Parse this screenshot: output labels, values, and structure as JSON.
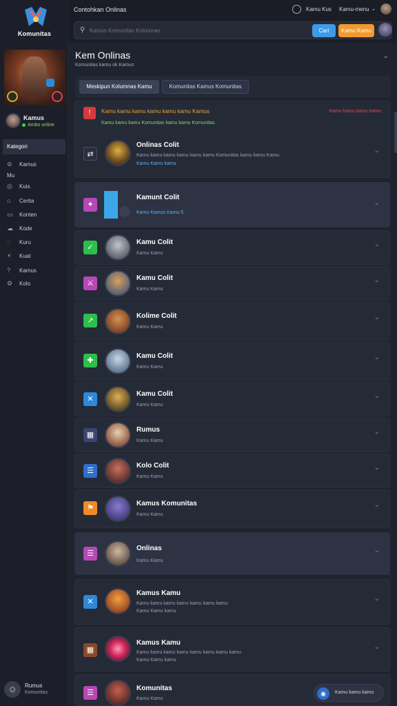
{
  "app": {
    "logo_text": "Komunitas",
    "window_title": "Contohkan Onlinas"
  },
  "topbar": {
    "link1": "Kamu Kus",
    "link2": "Kamu-menu"
  },
  "sidebar": {
    "user_name": "Kamus",
    "user_status": "Ambo online",
    "active_item": "Kategori",
    "items": [
      {
        "label": "Kamus",
        "icon": "compass-icon"
      },
      {
        "label": "Mu",
        "icon": ""
      },
      {
        "label": "Kuis",
        "icon": "eye-icon"
      },
      {
        "label": "Cerita",
        "icon": "flag-icon"
      },
      {
        "label": "Konten",
        "icon": "folder-icon"
      },
      {
        "label": "Kode",
        "icon": "cloud-icon"
      },
      {
        "label": "Kuru",
        "icon": "bubble-icon"
      },
      {
        "label": "Kuat",
        "icon": "bolt-icon"
      },
      {
        "label": "Kamus",
        "icon": "question-icon"
      },
      {
        "label": "Kolo",
        "icon": "gear-icon"
      }
    ],
    "footer_title": "Rumus",
    "footer_sub": "Komunitas"
  },
  "search": {
    "placeholder": "Kamus Komunitas Kolumnas",
    "btn_blue": "Cari",
    "btn_orange": "Kamu Kamu"
  },
  "main": {
    "title": "Kem Onlinas",
    "subtitle": "Komunitas kamu ok Kamus",
    "tab1": "Meskipun Kolumnas Kamu",
    "tab2": "Komunitas Kamus Komunitas"
  },
  "alert": {
    "title": "Kamu kamu kamu kamu kamu kamu Kamus",
    "right": "Kamu kamu kamu kamu",
    "green": "Kamu kamu kamu Komunitas kamu kamu Komunitas"
  },
  "rows": [
    {
      "title": "Onlinas Colit",
      "sub": "Kamu kamu kamu kamu kamu kamu Komunitas kamu kamu Kamu",
      "link": "Kamu Kamu kamu",
      "icon": "shuffle-icon",
      "icon_color": "#2b2f3e"
    },
    {
      "title": "Kamunt Colit",
      "link": "Kamu Kamus Kamu 5",
      "icon": "star-icon",
      "icon_color": "#b847b7"
    },
    {
      "title": "Kamu Colit",
      "sub": "Kamu Kamu",
      "icon": "check-icon",
      "icon_color": "#2dbf4b"
    },
    {
      "title": "Kamu Colit",
      "sub": "Kamu Kamu",
      "icon": "sword-icon",
      "icon_color": "#b847b7"
    },
    {
      "title": "Kolime Colit",
      "sub": "Kamu Kamu",
      "icon": "arrow-icon",
      "icon_color": "#2dbf4b"
    },
    {
      "title": "Kamu Colit",
      "sub": "Kamu Kamu",
      "icon": "plus-icon",
      "icon_color": "#2dbf4b"
    },
    {
      "title": "Kamu Colit",
      "sub": "Kamu Kamu",
      "icon": "x-icon",
      "icon_color": "#2f88d8"
    },
    {
      "title": "Rumus",
      "sub": "Kamu Kamu",
      "icon": "picture-icon",
      "icon_color": "#3a4670"
    },
    {
      "title": "Kolo Colit",
      "sub": "Kamu Kamu",
      "icon": "list-icon",
      "icon_color": "#2f6ec9"
    },
    {
      "title": "Kamus Komunitas",
      "sub": "Kamu Kamu",
      "icon": "flag-icon",
      "icon_color": "#f18a26"
    },
    {
      "title": "Onlinas",
      "sub": "Kamu Kamu",
      "icon": "list-icon",
      "icon_color": "#b847b7"
    },
    {
      "title": "Kamus Kamu",
      "sub": "Kamu kamu kamu kamu kamu kamu kamu",
      "sub2": "Kamu Kamu kamu",
      "icon": "x-icon",
      "icon_color": "#2f88d8"
    },
    {
      "title": "Kamus Kamu",
      "sub": "Kamu kamu kamu kamu kamu kamu kamu kamu",
      "sub2": "Kamu Kamu kamu",
      "icon": "picture-icon",
      "icon_color": "#8a4a2a"
    },
    {
      "title": "Komunitas",
      "sub": "Kamu Kamu",
      "icon": "list-icon",
      "icon_color": "#b847b7"
    }
  ],
  "bubble": {
    "label": "Kamu kamu kamu"
  },
  "colors": {
    "accent_blue": "#3d9be9",
    "accent_orange": "#f29a2e",
    "alert_red": "#d8393c",
    "online_green": "#4ccf59"
  }
}
